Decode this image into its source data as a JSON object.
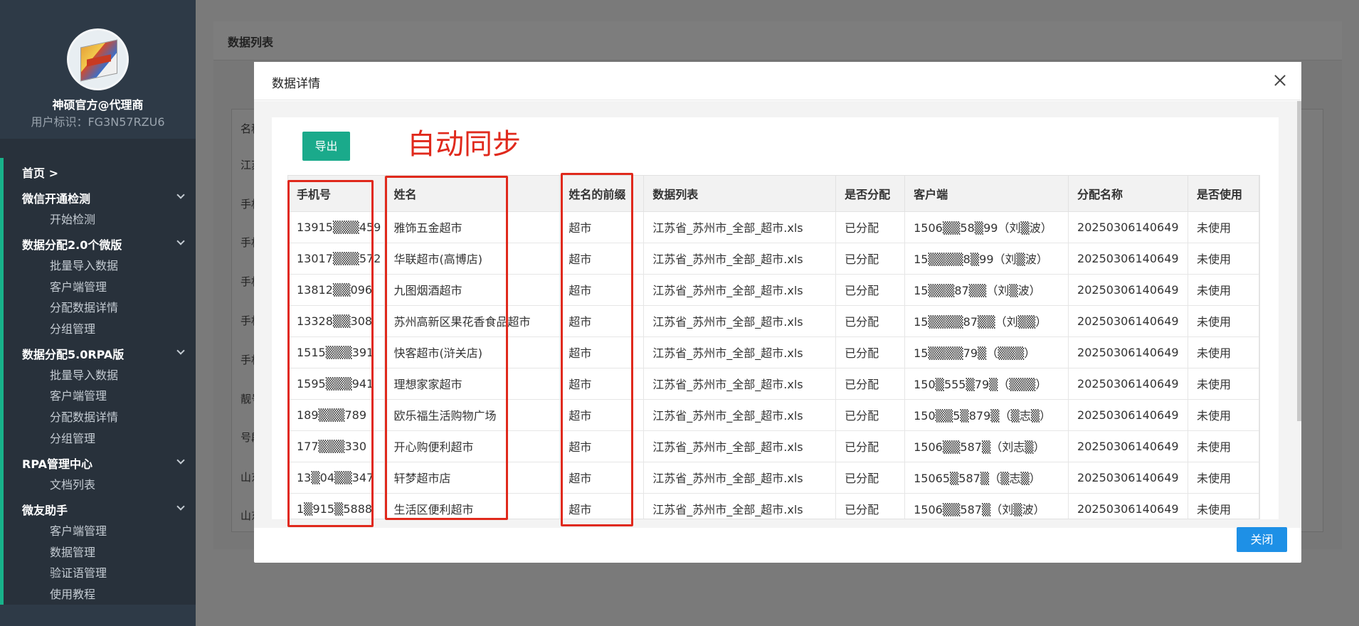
{
  "sidebar": {
    "profile_name": "神硕官方@代理商",
    "profile_id": "用户标识：FG3N57RZU6",
    "home": "首页 >",
    "groups": [
      {
        "label": "微信开通检测",
        "items": [
          "开始检测"
        ]
      },
      {
        "label": "数据分配2.0个微版",
        "items": [
          "批量导入数据",
          "客户端管理",
          "分配数据详情",
          "分组管理"
        ]
      },
      {
        "label": "数据分配5.0RPA版",
        "items": [
          "批量导入数据",
          "客户端管理",
          "分配数据详情",
          "分组管理"
        ]
      },
      {
        "label": "RPA管理中心",
        "items": [
          "文档列表"
        ]
      },
      {
        "label": "微友助手",
        "items": [
          "客户端管理",
          "数据管理",
          "验证语管理",
          "使用教程"
        ]
      }
    ]
  },
  "page": {
    "title": "数据列表",
    "bg_rows": [
      "名称",
      "江苏",
      "手机",
      "手机",
      "手机",
      "手机",
      "手机",
      "靓号",
      "号段",
      "山东",
      "山东"
    ]
  },
  "modal": {
    "title": "数据详情",
    "export_label": "导出",
    "annotation": "自动同步",
    "close_label": "关闭",
    "columns": [
      "手机号",
      "姓名",
      "姓名的前缀",
      "数据列表",
      "是否分配",
      "客户端",
      "分配名称",
      "是否使用"
    ],
    "rows": [
      [
        "13915▒▒▒459",
        "雅饰五金超市",
        "超市",
        "江苏省_苏州市_全部_超市.xls",
        "已分配",
        "1506▒▒58▒99（刘▒波）",
        "20250306140649",
        "未使用"
      ],
      [
        "13017▒▒▒572",
        "华联超市(高博店)",
        "超市",
        "江苏省_苏州市_全部_超市.xls",
        "已分配",
        "15▒▒▒▒8▒99（刘▒波）",
        "20250306140649",
        "未使用"
      ],
      [
        "13812▒▒096",
        "九图烟酒超市",
        "超市",
        "江苏省_苏州市_全部_超市.xls",
        "已分配",
        "15▒▒▒87▒▒（刘▒波）",
        "20250306140649",
        "未使用"
      ],
      [
        "13328▒▒308",
        "苏州高新区果花香食品超市",
        "超市",
        "江苏省_苏州市_全部_超市.xls",
        "已分配",
        "15▒▒▒▒87▒▒（刘▒▒）",
        "20250306140649",
        "未使用"
      ],
      [
        "1515▒▒▒391",
        "快客超市(浒关店)",
        "超市",
        "江苏省_苏州市_全部_超市.xls",
        "已分配",
        "15▒▒▒▒79▒（▒▒▒）",
        "20250306140649",
        "未使用"
      ],
      [
        "1595▒▒▒941",
        "理想家家超市",
        "超市",
        "江苏省_苏州市_全部_超市.xls",
        "已分配",
        "150▒555▒79▒（▒▒▒）",
        "20250306140649",
        "未使用"
      ],
      [
        "189▒▒▒789",
        "欧乐福生活购物广场",
        "超市",
        "江苏省_苏州市_全部_超市.xls",
        "已分配",
        "150▒▒5▒879▒（▒志▒）",
        "20250306140649",
        "未使用"
      ],
      [
        "177▒▒▒330",
        "开心购便利超市",
        "超市",
        "江苏省_苏州市_全部_超市.xls",
        "已分配",
        "1506▒▒587▒（刘志▒）",
        "20250306140649",
        "未使用"
      ],
      [
        "13▒04▒▒347",
        "轩梦超市店",
        "超市",
        "江苏省_苏州市_全部_超市.xls",
        "已分配",
        "15065▒587▒（▒志▒）",
        "20250306140649",
        "未使用"
      ],
      [
        "1▒915▒5888",
        "生活区便利超市",
        "超市",
        "江苏省_苏州市_全部_超市.xls",
        "已分配",
        "1506▒▒587▒（刘▒波）",
        "20250306140649",
        "未使用"
      ]
    ]
  }
}
